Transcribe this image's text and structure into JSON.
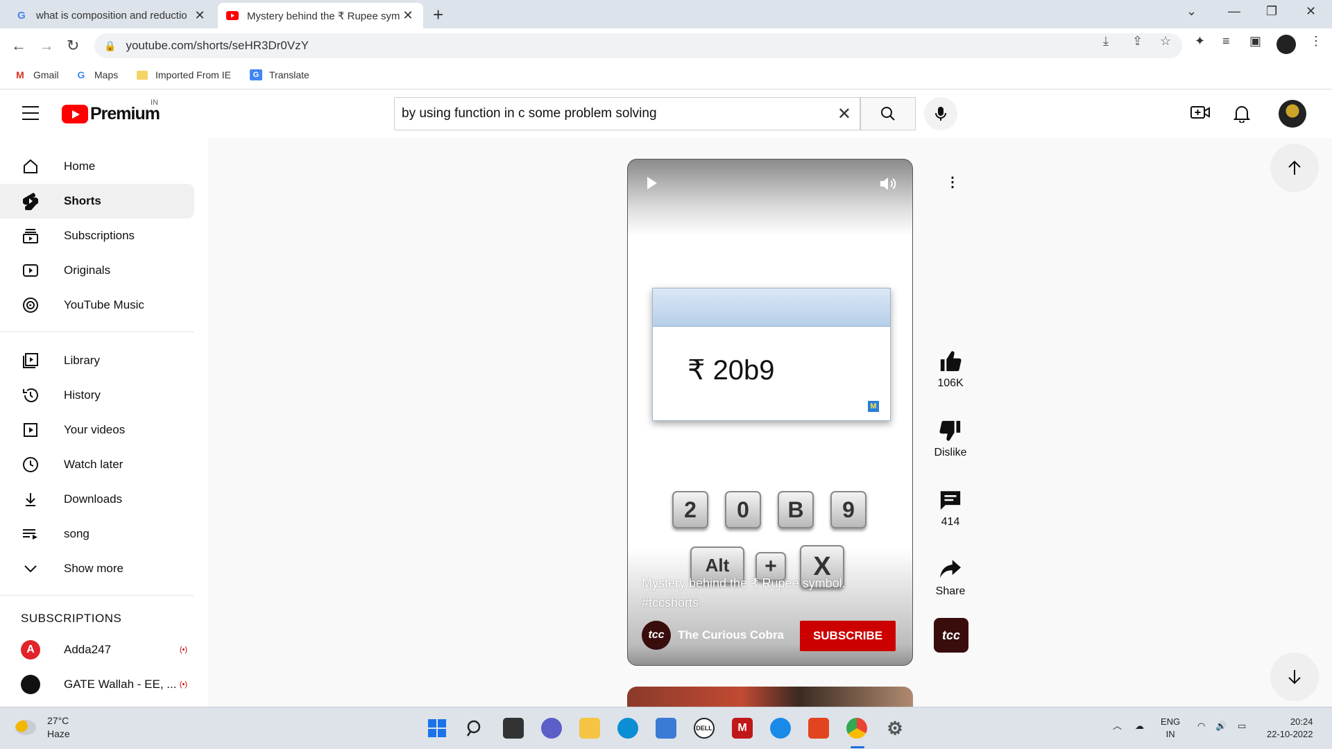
{
  "browser": {
    "tabs": [
      {
        "title": "what is composition and reductio",
        "favicon": "google-g-icon",
        "active": false
      },
      {
        "title": "Mystery behind the ₹ Rupee sym",
        "favicon": "youtube-icon",
        "active": true
      }
    ],
    "url": "youtube.com/shorts/seHR3Dr0VzY",
    "bookmarks": [
      {
        "label": "Gmail",
        "icon": "gmail-icon"
      },
      {
        "label": "Maps",
        "icon": "google-g-icon"
      },
      {
        "label": "Imported From IE",
        "icon": "folder-icon"
      },
      {
        "label": "Translate",
        "icon": "translate-icon"
      }
    ]
  },
  "youtube": {
    "logo_text": "Premium",
    "country_code": "IN",
    "search_value": "by using function in c some problem solving",
    "sidebar": {
      "main": [
        {
          "label": "Home",
          "icon": "home-icon"
        },
        {
          "label": "Shorts",
          "icon": "shorts-icon",
          "active": true
        },
        {
          "label": "Subscriptions",
          "icon": "subscriptions-icon"
        },
        {
          "label": "Originals",
          "icon": "originals-icon"
        },
        {
          "label": "YouTube Music",
          "icon": "youtube-music-icon"
        }
      ],
      "library": [
        {
          "label": "Library",
          "icon": "library-icon"
        },
        {
          "label": "History",
          "icon": "history-icon"
        },
        {
          "label": "Your videos",
          "icon": "your-videos-icon"
        },
        {
          "label": "Watch later",
          "icon": "clock-icon"
        },
        {
          "label": "Downloads",
          "icon": "download-icon"
        },
        {
          "label": "song",
          "icon": "playlist-icon"
        },
        {
          "label": "Show more",
          "icon": "chevron-down-icon"
        }
      ],
      "subscriptions_heading": "SUBSCRIPTIONS",
      "subscriptions": [
        {
          "label": "Adda247",
          "live": "(•)"
        },
        {
          "label": "GATE Wallah - EE, ...",
          "live": "(•)"
        }
      ]
    },
    "short": {
      "screen_text": "₹ 20b9",
      "keys_row1": [
        "2",
        "0",
        "B",
        "9"
      ],
      "keys_row2": [
        "Alt",
        "+",
        "X"
      ],
      "caption": "Mystery behind the ₹ Rupee symbol. #tccshorts",
      "channel_logo": "tcc",
      "channel_name": "The Curious Cobra",
      "subscribe_label": "SUBSCRIBE"
    },
    "actions": {
      "likes": "106K",
      "dislike": "Dislike",
      "comments": "414",
      "share": "Share"
    }
  },
  "taskbar": {
    "temperature": "27°C",
    "weather": "Haze",
    "language": "ENG",
    "region": "IN",
    "time": "20:24",
    "date": "22-10-2022"
  },
  "colors": {
    "youtube_red": "#ff0000",
    "subscribe_red": "#cc0000",
    "link_blue": "#1a6dd8"
  }
}
